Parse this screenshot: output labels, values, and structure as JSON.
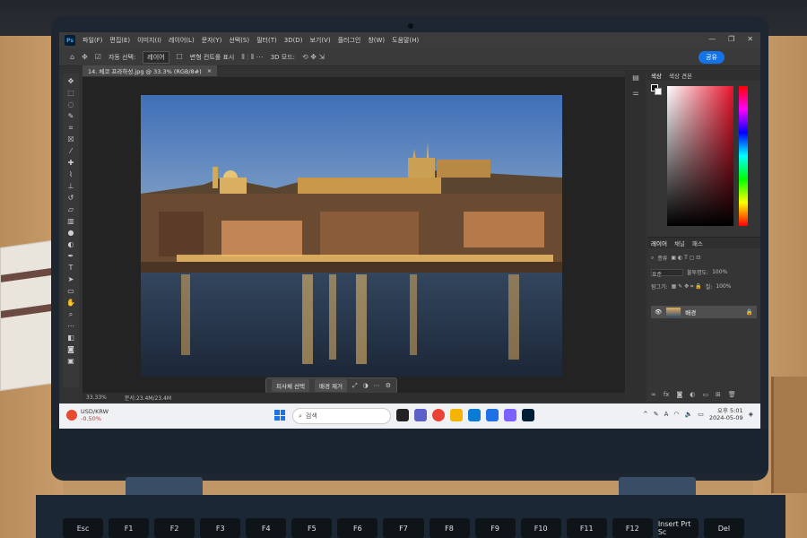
{
  "photoshop": {
    "menu": [
      "파일(F)",
      "편집(E)",
      "이미지(I)",
      "레이어(L)",
      "문자(Y)",
      "선택(S)",
      "필터(T)",
      "3D(D)",
      "보기(V)",
      "플러그인",
      "창(W)",
      "도움말(H)"
    ],
    "options": {
      "auto_select_label": "자동 선택:",
      "auto_select_value": "레이어",
      "transform_controls_label": "변형 컨트롤 표시",
      "mode_3d_label": "3D 모드:",
      "share_label": "공유"
    },
    "document_tab": "14. 체코 프라하성.jpg @ 33.3% (RGB/8#)",
    "status": {
      "zoom": "33.33%",
      "doc_size": "문서:23.4M/23.4M"
    },
    "context_bar": {
      "select_subject": "피사체 선택",
      "remove_background": "배경 제거"
    },
    "color_panel": {
      "tabs": [
        "색상",
        "색상 견본"
      ]
    },
    "layers_panel": {
      "tabs": [
        "레이어",
        "채널",
        "패스"
      ],
      "kind_label": "종류",
      "blend_mode": "표준",
      "opacity_label": "불투명도:",
      "opacity_value": "100%",
      "lock_label": "잠그기:",
      "fill_label": "칠:",
      "fill_value": "100%",
      "layer_name": "배경"
    }
  },
  "taskbar": {
    "weather_label": "USD/KRW",
    "weather_change": "-0.50%",
    "search_placeholder": "검색",
    "time": "오후 5:01",
    "date": "2024-05-09",
    "colors": {
      "start": "#1a73e8",
      "accent": "#1473e6"
    }
  },
  "keyboard": [
    "Esc",
    "F1",
    "F2",
    "F3",
    "F4",
    "F5",
    "F6",
    "F7",
    "F8",
    "F9",
    "F10",
    "F11",
    "F12",
    "Insert Prt Sc",
    "Del"
  ]
}
